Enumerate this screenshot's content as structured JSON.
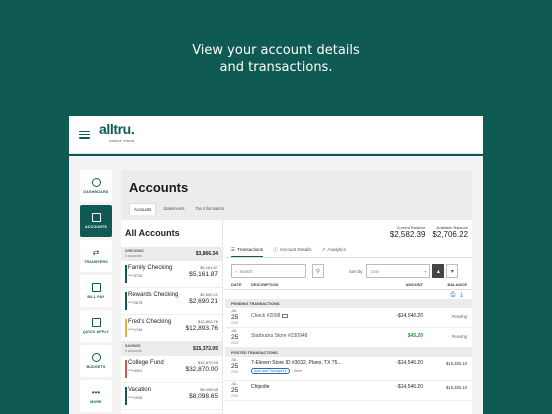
{
  "headline": {
    "line1": "View your account details",
    "line2": "and transactions."
  },
  "app": {
    "logo": "alltru.",
    "logo_sub": "CREDIT UNION"
  },
  "colors": {
    "brand": "#0f5a52",
    "link": "#1f6fb5",
    "credit": "#2e8b3e"
  },
  "nav": [
    {
      "label": "DASHBOARD",
      "icon": "dashboard-gauge-icon",
      "active": false
    },
    {
      "label": "ACCOUNTS",
      "icon": "wallet-icon",
      "active": true
    },
    {
      "label": "TRANSFERS",
      "icon": "transfer-arrows-icon",
      "active": false
    },
    {
      "label": "BILL PAY",
      "icon": "bill-icon",
      "active": false
    },
    {
      "label": "QUICK APPLY",
      "icon": "clipboard-icon",
      "active": false
    },
    {
      "label": "BUDGETS",
      "icon": "dollar-circle-icon",
      "active": false
    },
    {
      "label": "MORE",
      "icon": "more-dots-icon",
      "active": false
    }
  ],
  "page": {
    "title": "Accounts",
    "tabs": [
      "Accounts",
      "Statements",
      "Tax Information"
    ]
  },
  "accounts": {
    "heading": "All Accounts",
    "checking": {
      "name": "CHECKING",
      "count": "3 accounts",
      "total": "$3,866.34"
    },
    "checking_items": [
      {
        "name": "Family Checking",
        "number": "****3726",
        "bal1": "$5,161.87",
        "bal2": "$5,161.87",
        "color": "#0f5a52"
      },
      {
        "name": "Rewards Checking",
        "number": "****2878",
        "bal1": "$2,690.21",
        "bal2": "$2,690.21",
        "color": "#0f5a52"
      },
      {
        "name": "Fred's Checking",
        "number": "****1746",
        "bal1": "$12,893.76",
        "bal2": "$12,893.76",
        "color": "#e0b23a"
      }
    ],
    "savings": {
      "name": "SAVINGS",
      "count": "3 accounts",
      "total": "$15,372.05"
    },
    "savings_items": [
      {
        "name": "College Fund",
        "number": "****4001",
        "bal1": "$32,870.00",
        "bal2": "$32,870.00",
        "color": "#d9534f"
      },
      {
        "name": "Vacation",
        "number": "****1928",
        "bal1": "$8,098.65",
        "bal2": "$8,098.65",
        "color": "#0f5a52"
      }
    ]
  },
  "balances": {
    "current_label": "Current Balance",
    "current_value": "$2,582.39",
    "available_label": "Available Balance",
    "available_value": "$2,706.22"
  },
  "subtabs": [
    "Transactions",
    "Account Details",
    "Analytics"
  ],
  "filters": {
    "search_placeholder": "Search",
    "sort_label": "Sort by:",
    "sort_value": "Date"
  },
  "table": {
    "headers": [
      "DATE",
      "DESCRIPTION",
      "AMOUNT",
      "BALANCE"
    ],
    "pending_label": "PENDING TRANSACTIONS",
    "posted_label": "POSTED TRANSACTIONS",
    "pending": [
      {
        "month": "JUL",
        "day": "25",
        "year": "2019",
        "desc": "Check #2098",
        "amount": "-$14,546.20",
        "balance": "Pending"
      },
      {
        "month": "JUL",
        "day": "25",
        "year": "2019",
        "desc": "Starbucks Store #230948",
        "amount": "$45.20",
        "balance": "Pending"
      }
    ],
    "posted": [
      {
        "month": "JUL",
        "day": "25",
        "year": "2019",
        "desc": "7-Eleven Store ID #3032, Plano, TX 75...",
        "tag": "Auto and Transport",
        "type": "Debit",
        "amount": "-$14,546.20",
        "balance": "$15,392.10"
      },
      {
        "month": "JUL",
        "day": "25",
        "year": "2019",
        "desc": "Chipotle",
        "amount": "-$14,546.20",
        "balance": "$15,392.10"
      }
    ]
  }
}
